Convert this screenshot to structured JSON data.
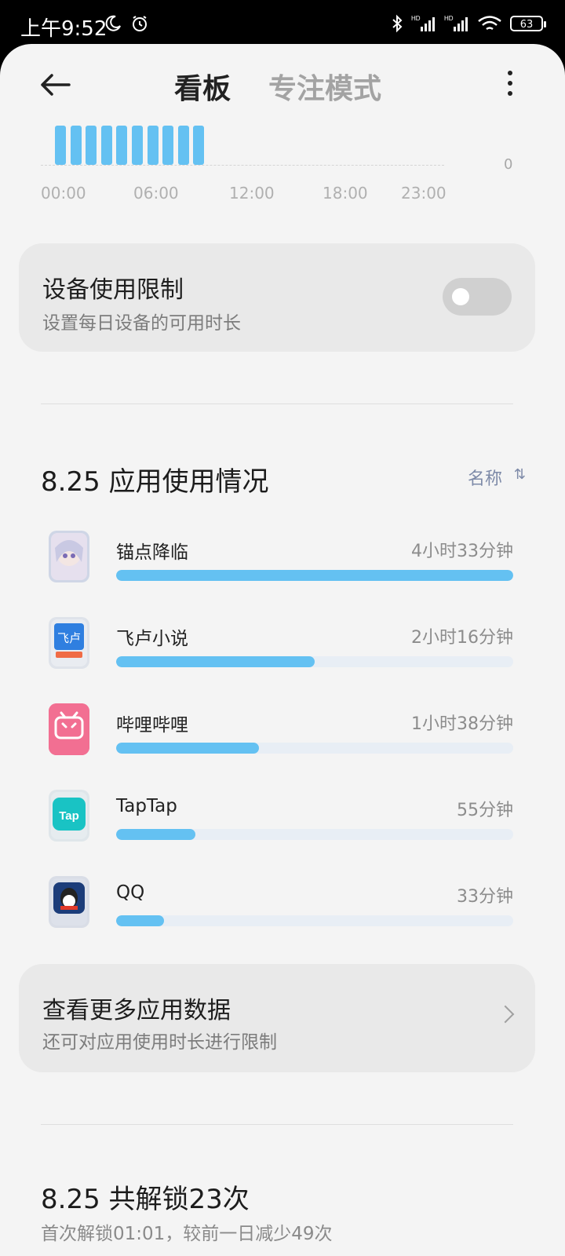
{
  "status_bar": {
    "time": "上午9:52",
    "battery": "63",
    "hd1": "HD",
    "hd2": "HD"
  },
  "header": {
    "back_icon": "back-arrow-icon",
    "tab_active": "看板",
    "tab_inactive": "专注模式",
    "more_icon": "more-vertical-icon"
  },
  "hour_chart": {
    "tick_labels": [
      "00:00",
      "06:00",
      "12:00",
      "18:00",
      "23:00"
    ],
    "zero_label": "0",
    "bar_color": "#64c1f2",
    "active_bars": 10
  },
  "device_limit": {
    "title": "设备使用限制",
    "subtitle": "设置每日设备的可用时长",
    "enabled": false
  },
  "app_usage": {
    "title": "8.25 应用使用情况",
    "sort_label": "名称",
    "apps": [
      {
        "name": "锚点降临",
        "time": "4小时33分钟",
        "fraction": 1.0,
        "icon": "anime-character-app-icon"
      },
      {
        "name": "飞卢小说",
        "time": "2小时16分钟",
        "fraction": 0.5,
        "icon": "feilu-app-icon"
      },
      {
        "name": "哔哩哔哩",
        "time": "1小时38分钟",
        "fraction": 0.36,
        "icon": "bilibili-app-icon"
      },
      {
        "name": "TapTap",
        "time": "55分钟",
        "fraction": 0.2,
        "icon": "taptap-app-icon"
      },
      {
        "name": "QQ",
        "time": "33分钟",
        "fraction": 0.12,
        "icon": "qq-app-icon"
      }
    ],
    "bar_color": "#64c1f2"
  },
  "more_data": {
    "title": "查看更多应用数据",
    "subtitle": "还可对应用使用时长进行限制"
  },
  "unlock": {
    "title": "8.25 共解锁23次",
    "subtitle": "首次解锁01:01，较前一日减少49次"
  }
}
